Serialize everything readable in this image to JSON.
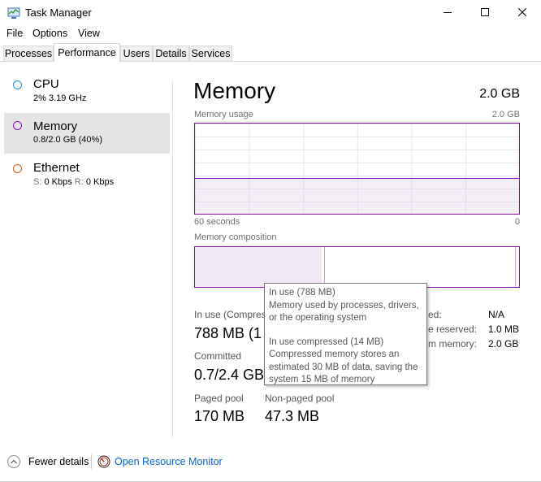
{
  "window": {
    "title": "Task Manager",
    "icon": "task-manager-icon",
    "controls": [
      "minimize-icon",
      "maximize-icon",
      "close-icon"
    ]
  },
  "menu": [
    "File",
    "Options",
    "View"
  ],
  "tabs": [
    {
      "label": "Processes",
      "active": false
    },
    {
      "label": "Performance",
      "active": true
    },
    {
      "label": "Users",
      "active": false
    },
    {
      "label": "Details",
      "active": false
    },
    {
      "label": "Services",
      "active": false
    }
  ],
  "sidebar": {
    "items": [
      {
        "title": "CPU",
        "sub": "2% 3.19 GHz",
        "color": "#1e90d6",
        "selected": false
      },
      {
        "title": "Memory",
        "sub": "0.8/2.0 GB (40%)",
        "color": "#8b12ae",
        "selected": true
      },
      {
        "title": "Ethernet",
        "sub_parts": {
          "s_label": "S:",
          "s_value": "0 Kbps",
          "r_label": "R:",
          "r_value": "0 Kbps"
        },
        "color": "#c75b12",
        "selected": false
      }
    ]
  },
  "main": {
    "heading": "Memory",
    "total": "2.0 GB",
    "usage_label": "Memory usage",
    "usage_max": "2.0 GB",
    "usage_fraction": 0.4,
    "time_left": "60 seconds",
    "time_right": "0",
    "composition_label": "Memory composition",
    "composition": {
      "in_use_fraction": 0.39,
      "compressed_fraction": 0.007
    },
    "accent": "#8b12ae",
    "stats": {
      "in_use_label": "In use (Compres",
      "in_use_value": "788 MB (1",
      "committed_label": "Committed",
      "committed_value": "0.7/2.4 GB",
      "paged_label": "Paged pool",
      "paged_value": "170 MB",
      "nonpaged_label": "Non-paged pool",
      "nonpaged_value": "47.3 MB"
    },
    "right": {
      "row1_label": "ed:",
      "row1_value": "N/A",
      "row2_label": "e reserved:",
      "row2_value": "1.0 MB",
      "row3_label": "m memory:",
      "row3_value": "2.0 GB"
    }
  },
  "tooltip": {
    "line1": "In use (788 MB)",
    "line2": "Memory used by processes, drivers,",
    "line3": "or the operating system",
    "line4": "In use compressed (14 MB)",
    "line5": "Compressed memory stores an",
    "line6": "estimated 30 MB of data, saving the",
    "line7": "system 15 MB of memory"
  },
  "footer": {
    "fewer_details": "Fewer details",
    "fewer_icon": "chevron-up-icon",
    "resource_monitor": "Open Resource Monitor",
    "resource_icon": "resource-monitor-icon"
  }
}
